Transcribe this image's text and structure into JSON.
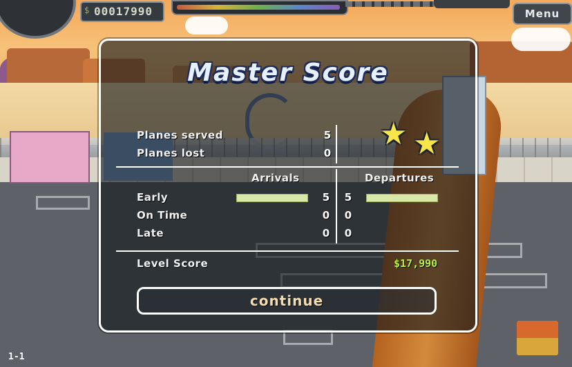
{
  "hud": {
    "currency_symbol": "$",
    "score": "00017990",
    "menu_label": "Menu",
    "level": "1-1"
  },
  "dialog": {
    "title": "Master Score",
    "planes_served_label": "Planes served",
    "planes_served": "5",
    "planes_lost_label": "Planes lost",
    "planes_lost": "0",
    "stars": 2,
    "arrivals_label": "Arrivals",
    "departures_label": "Departures",
    "rows": [
      {
        "label": "Early",
        "arrivals": "5",
        "departures": "5",
        "arrivals_fraction": 1,
        "departures_fraction": 1
      },
      {
        "label": "On Time",
        "arrivals": "0",
        "departures": "0",
        "arrivals_fraction": 0,
        "departures_fraction": 0
      },
      {
        "label": "Late",
        "arrivals": "0",
        "departures": "0",
        "arrivals_fraction": 0,
        "departures_fraction": 0
      }
    ],
    "level_score_label": "Level Score",
    "level_score": "$17,990",
    "continue_label": "continue"
  },
  "colors": {
    "accent_green": "#b7f23a",
    "star_yellow": "#f7e54a",
    "bar_fill": "#d9e8a8"
  }
}
